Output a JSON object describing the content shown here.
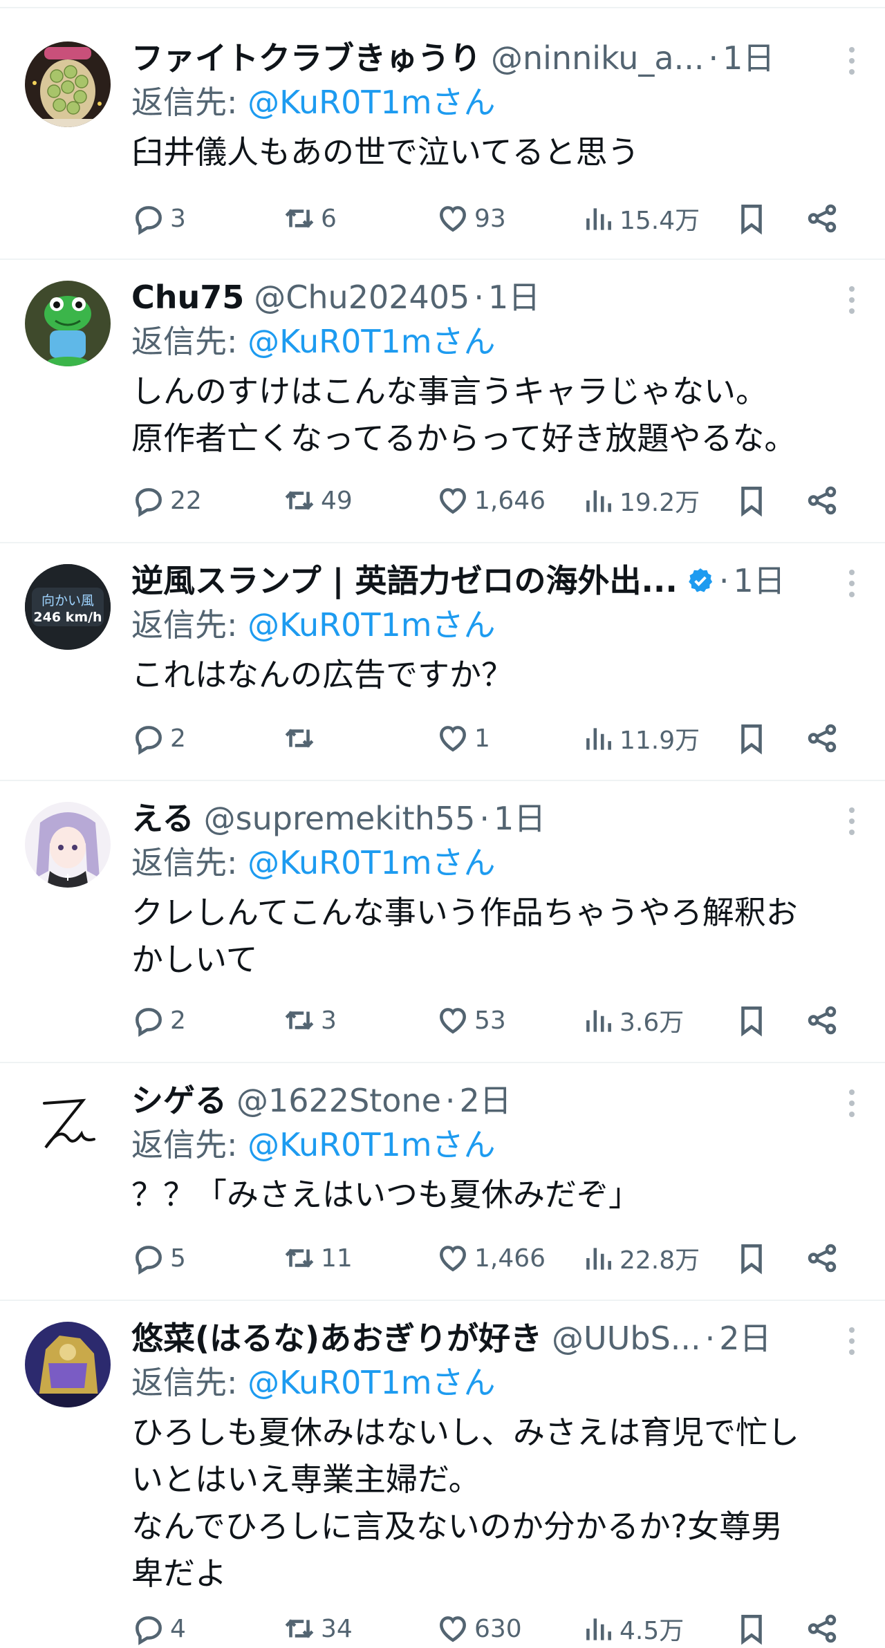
{
  "reply_prefix": "返信先:",
  "reply_target": "@KuR0T1mさん",
  "tweets": [
    {
      "name": "ファイトクラブきゅうり",
      "handle": "@ninniku_a...",
      "time": "1日",
      "text": "臼井儀人もあの世で泣いてると思う",
      "replies": "3",
      "retweets": "6",
      "likes": "93",
      "views": "15.4万"
    },
    {
      "name": "Chu75",
      "handle": "@Chu202405",
      "time": "1日",
      "text": "しんのすけはこんな事言うキャラじゃない。\n原作者亡くなってるからって好き放題やるな。",
      "replies": "22",
      "retweets": "49",
      "likes": "1,646",
      "views": "19.2万"
    },
    {
      "name": "逆風スランプ | 英語力ゼロの海外出...",
      "handle": "",
      "time": "1日",
      "text": "これはなんの広告ですか？",
      "replies": "2",
      "retweets": "",
      "likes": "1",
      "views": "11.9万",
      "avatar_line1": "向かい風",
      "avatar_line2": "246 km/h"
    },
    {
      "name": "える",
      "handle": "@supremekith55",
      "time": "1日",
      "text": "クレしんてこんな事いう作品ちゃうやろ解釈お\nかしいて",
      "replies": "2",
      "retweets": "3",
      "likes": "53",
      "views": "3.6万"
    },
    {
      "name": "シゲる",
      "handle": "@1622Stone",
      "time": "2日",
      "text": "？？「みさえはいつも夏休みだぞ」",
      "replies": "5",
      "retweets": "11",
      "likes": "1,466",
      "views": "22.8万"
    },
    {
      "name": "悠菜(はるな)あおぎりが好き",
      "handle": "@UUbS...",
      "time": "2日",
      "text": "ひろしも夏休みはないし、みさえは育児で忙し\nいとはいえ専業主婦だ。\nなんでひろしに言及ないのか分かるか?女尊男\n卑だよ",
      "replies": "4",
      "retweets": "34",
      "likes": "630",
      "views": "4.5万"
    }
  ],
  "colors": {
    "link": "#1d9bf0",
    "muted": "#536471",
    "text": "#0f1419",
    "verified": "#1d9bf0"
  },
  "icons": [
    "reply-icon",
    "retweet-icon",
    "like-icon",
    "views-icon",
    "bookmark-icon",
    "share-icon",
    "more-icon",
    "verified-badge-icon"
  ]
}
